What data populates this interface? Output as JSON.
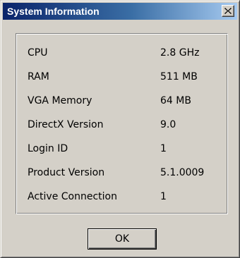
{
  "window": {
    "title": "System Information",
    "close_icon": "close-icon"
  },
  "info_rows": [
    {
      "label": "CPU",
      "value": "2.8 GHz"
    },
    {
      "label": "RAM",
      "value": "511 MB"
    },
    {
      "label": "VGA Memory",
      "value": "64 MB"
    },
    {
      "label": "DirectX Version",
      "value": "9.0"
    },
    {
      "label": "Login ID",
      "value": "1"
    },
    {
      "label": "Product Version",
      "value": "5.1.0009"
    },
    {
      "label": "Active Connection",
      "value": "1"
    }
  ],
  "buttons": {
    "ok_label": "OK"
  },
  "colors": {
    "titlebar_start": "#0a246a",
    "titlebar_end": "#a6caf0",
    "dialog_face": "#d4d0c8"
  }
}
